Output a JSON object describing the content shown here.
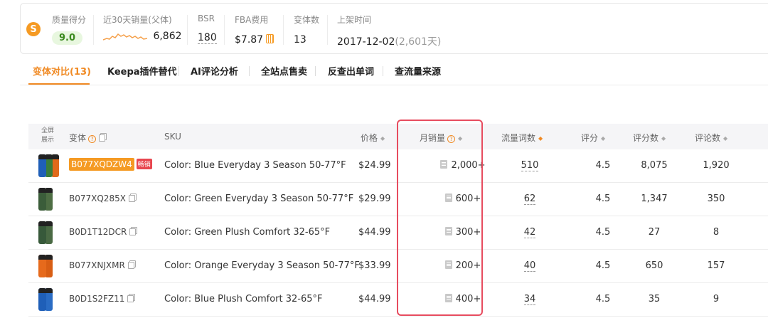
{
  "stats": {
    "quality_score": {
      "label": "质量得分",
      "value": "9.0"
    },
    "sales_30d": {
      "label": "近30天销量(父体)",
      "value": "6,862"
    },
    "bsr": {
      "label": "BSR",
      "value": "180"
    },
    "fba_fee": {
      "label": "FBA费用",
      "value": "$7.87"
    },
    "variant_count": {
      "label": "变体数",
      "value": "13"
    },
    "listed_date": {
      "label": "上架时间",
      "value": "2017-12-02",
      "days": "(2,601天)"
    }
  },
  "tabs": [
    {
      "label": "变体对比(13)",
      "active": true
    },
    {
      "label": "Keepa插件替代"
    },
    {
      "label": "AI评论分析"
    },
    {
      "label": "全站点售卖"
    },
    {
      "label": "反查出单词"
    },
    {
      "label": "查流量来源"
    }
  ],
  "table": {
    "headers": {
      "fullscreen": "全屏",
      "display": "展示",
      "variant": "变体",
      "sku": "SKU",
      "price": "价格",
      "monthly_sales": "月销量",
      "traffic_words": "流量词数",
      "rating": "评分",
      "rating_count": "评分数",
      "review_count": "评论数"
    },
    "best_seller_badge": "畅销",
    "rows": [
      {
        "asin": "B077XQDZW4",
        "highlight": true,
        "best": true,
        "sku": "Color: Blue Everyday 3 Season 50-77°F",
        "price": "$24.99",
        "monthly_sales": "2,000+",
        "traffic_words": "510",
        "rating": "4.5",
        "rating_count": "8,075",
        "review_count": "1,920",
        "colors": [
          "#1f5fb8",
          "#3b7d3a",
          "#e06a1b"
        ]
      },
      {
        "asin": "B077XQ285X",
        "sku": "Color: Green Everyday 3 Season 50-77°F",
        "price": "$29.99",
        "monthly_sales": "600+",
        "traffic_words": "62",
        "rating": "4.5",
        "rating_count": "1,347",
        "review_count": "350",
        "colors": [
          "#3b5d3a",
          "#4e6e44"
        ]
      },
      {
        "asin": "B0D1T12DCR",
        "sku": "Color: Green Plush Comfort 32-65°F",
        "price": "$44.99",
        "monthly_sales": "300+",
        "traffic_words": "42",
        "rating": "4.5",
        "rating_count": "27",
        "review_count": "8",
        "colors": [
          "#37593a",
          "#4a6a44"
        ]
      },
      {
        "asin": "B077XNJXMR",
        "sku": "Color: Orange Everyday 3 Season 50-77°F",
        "price": "$33.99",
        "monthly_sales": "200+",
        "traffic_words": "40",
        "rating": "4.5",
        "rating_count": "650",
        "review_count": "157",
        "colors": [
          "#e66a1c",
          "#d85e14"
        ]
      },
      {
        "asin": "B0D1S2FZ11",
        "sku": "Color: Blue Plush Comfort 32-65°F",
        "price": "$44.99",
        "monthly_sales": "400+",
        "traffic_words": "34",
        "rating": "4.5",
        "rating_count": "35",
        "review_count": "9",
        "colors": [
          "#1f5fb8",
          "#2a6cc4"
        ]
      }
    ]
  },
  "colors": {
    "accent": "#f08a24",
    "highlight_box": "#e74c5f",
    "best_badge": "#e8464f",
    "score_badge_bg": "#e8f7df"
  }
}
